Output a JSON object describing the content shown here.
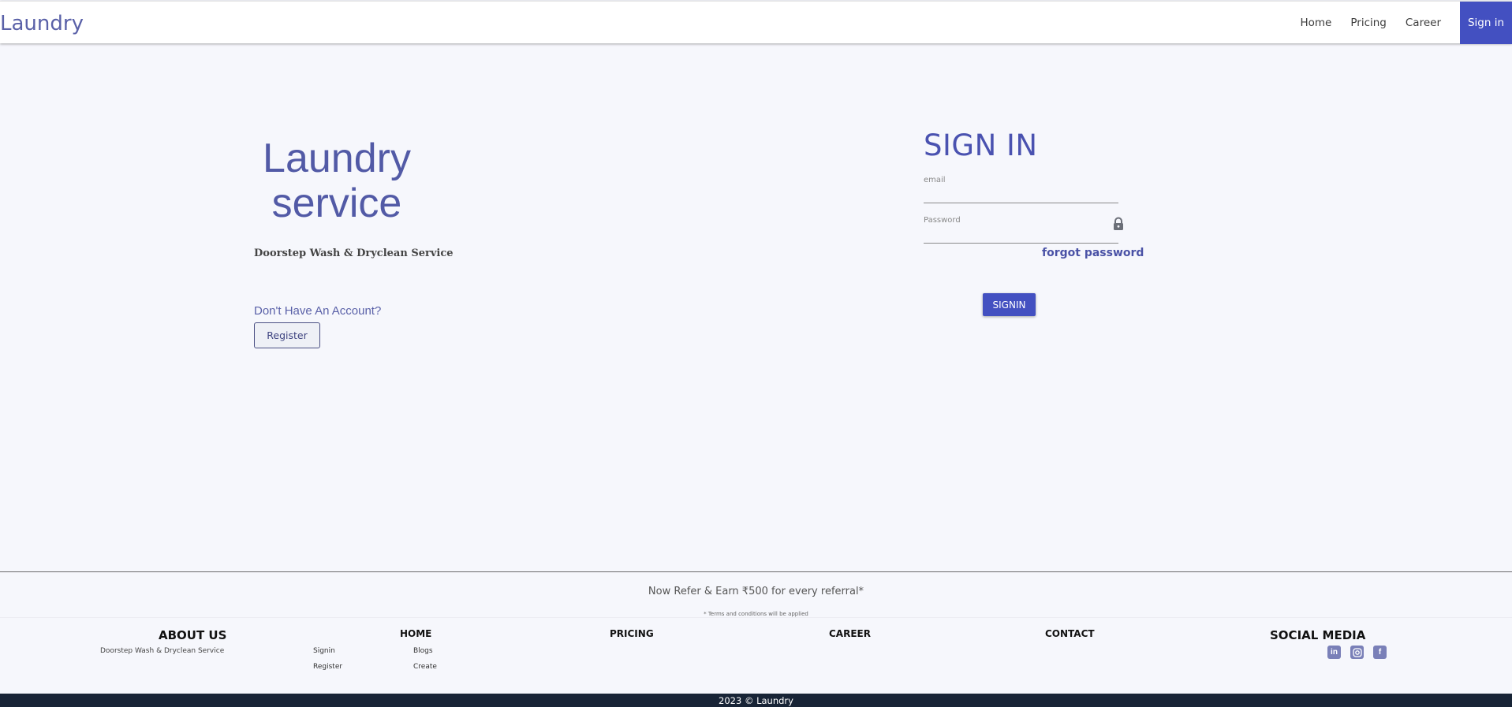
{
  "nav": {
    "brand": "Laundry",
    "links": [
      "Home",
      "Pricing",
      "Career"
    ],
    "signin_label": "Sign in"
  },
  "hero": {
    "title_line1": "Laundry",
    "title_line2": "service",
    "subtitle": "Doorstep Wash & Dryclean Service",
    "no_account": "Don't Have An Account?",
    "register_label": "Register"
  },
  "signin": {
    "title": "SIGN IN",
    "email_label": "email",
    "email_value": "",
    "password_label": "Password",
    "password_value": "",
    "forgot_label": "forgot password",
    "submit_label": "SIGNIN"
  },
  "refer": {
    "text": "Now Refer & Earn ₹500 for every referral*",
    "terms": "* Terms and conditions will be applied"
  },
  "footer": {
    "about_heading": "ABOUT US",
    "about_text": "Doorstep Wash & Dryclean Service",
    "home_heading": "HOME",
    "home_links": [
      "Signin",
      "Register",
      "Blogs",
      "Create"
    ],
    "pricing_heading": "PRICING",
    "career_heading": "CAREER",
    "contact_heading": "CONTACT",
    "social_heading": "SOCIAL MEDIA",
    "social_icons": [
      "linkedin-icon",
      "instagram-icon",
      "facebook-icon"
    ]
  },
  "copyright": "2023 © Laundry",
  "colors": {
    "accent": "#4350c1",
    "brand_text": "#5a61a8",
    "background": "#f6f7fc",
    "bottom_bar": "#182436"
  }
}
